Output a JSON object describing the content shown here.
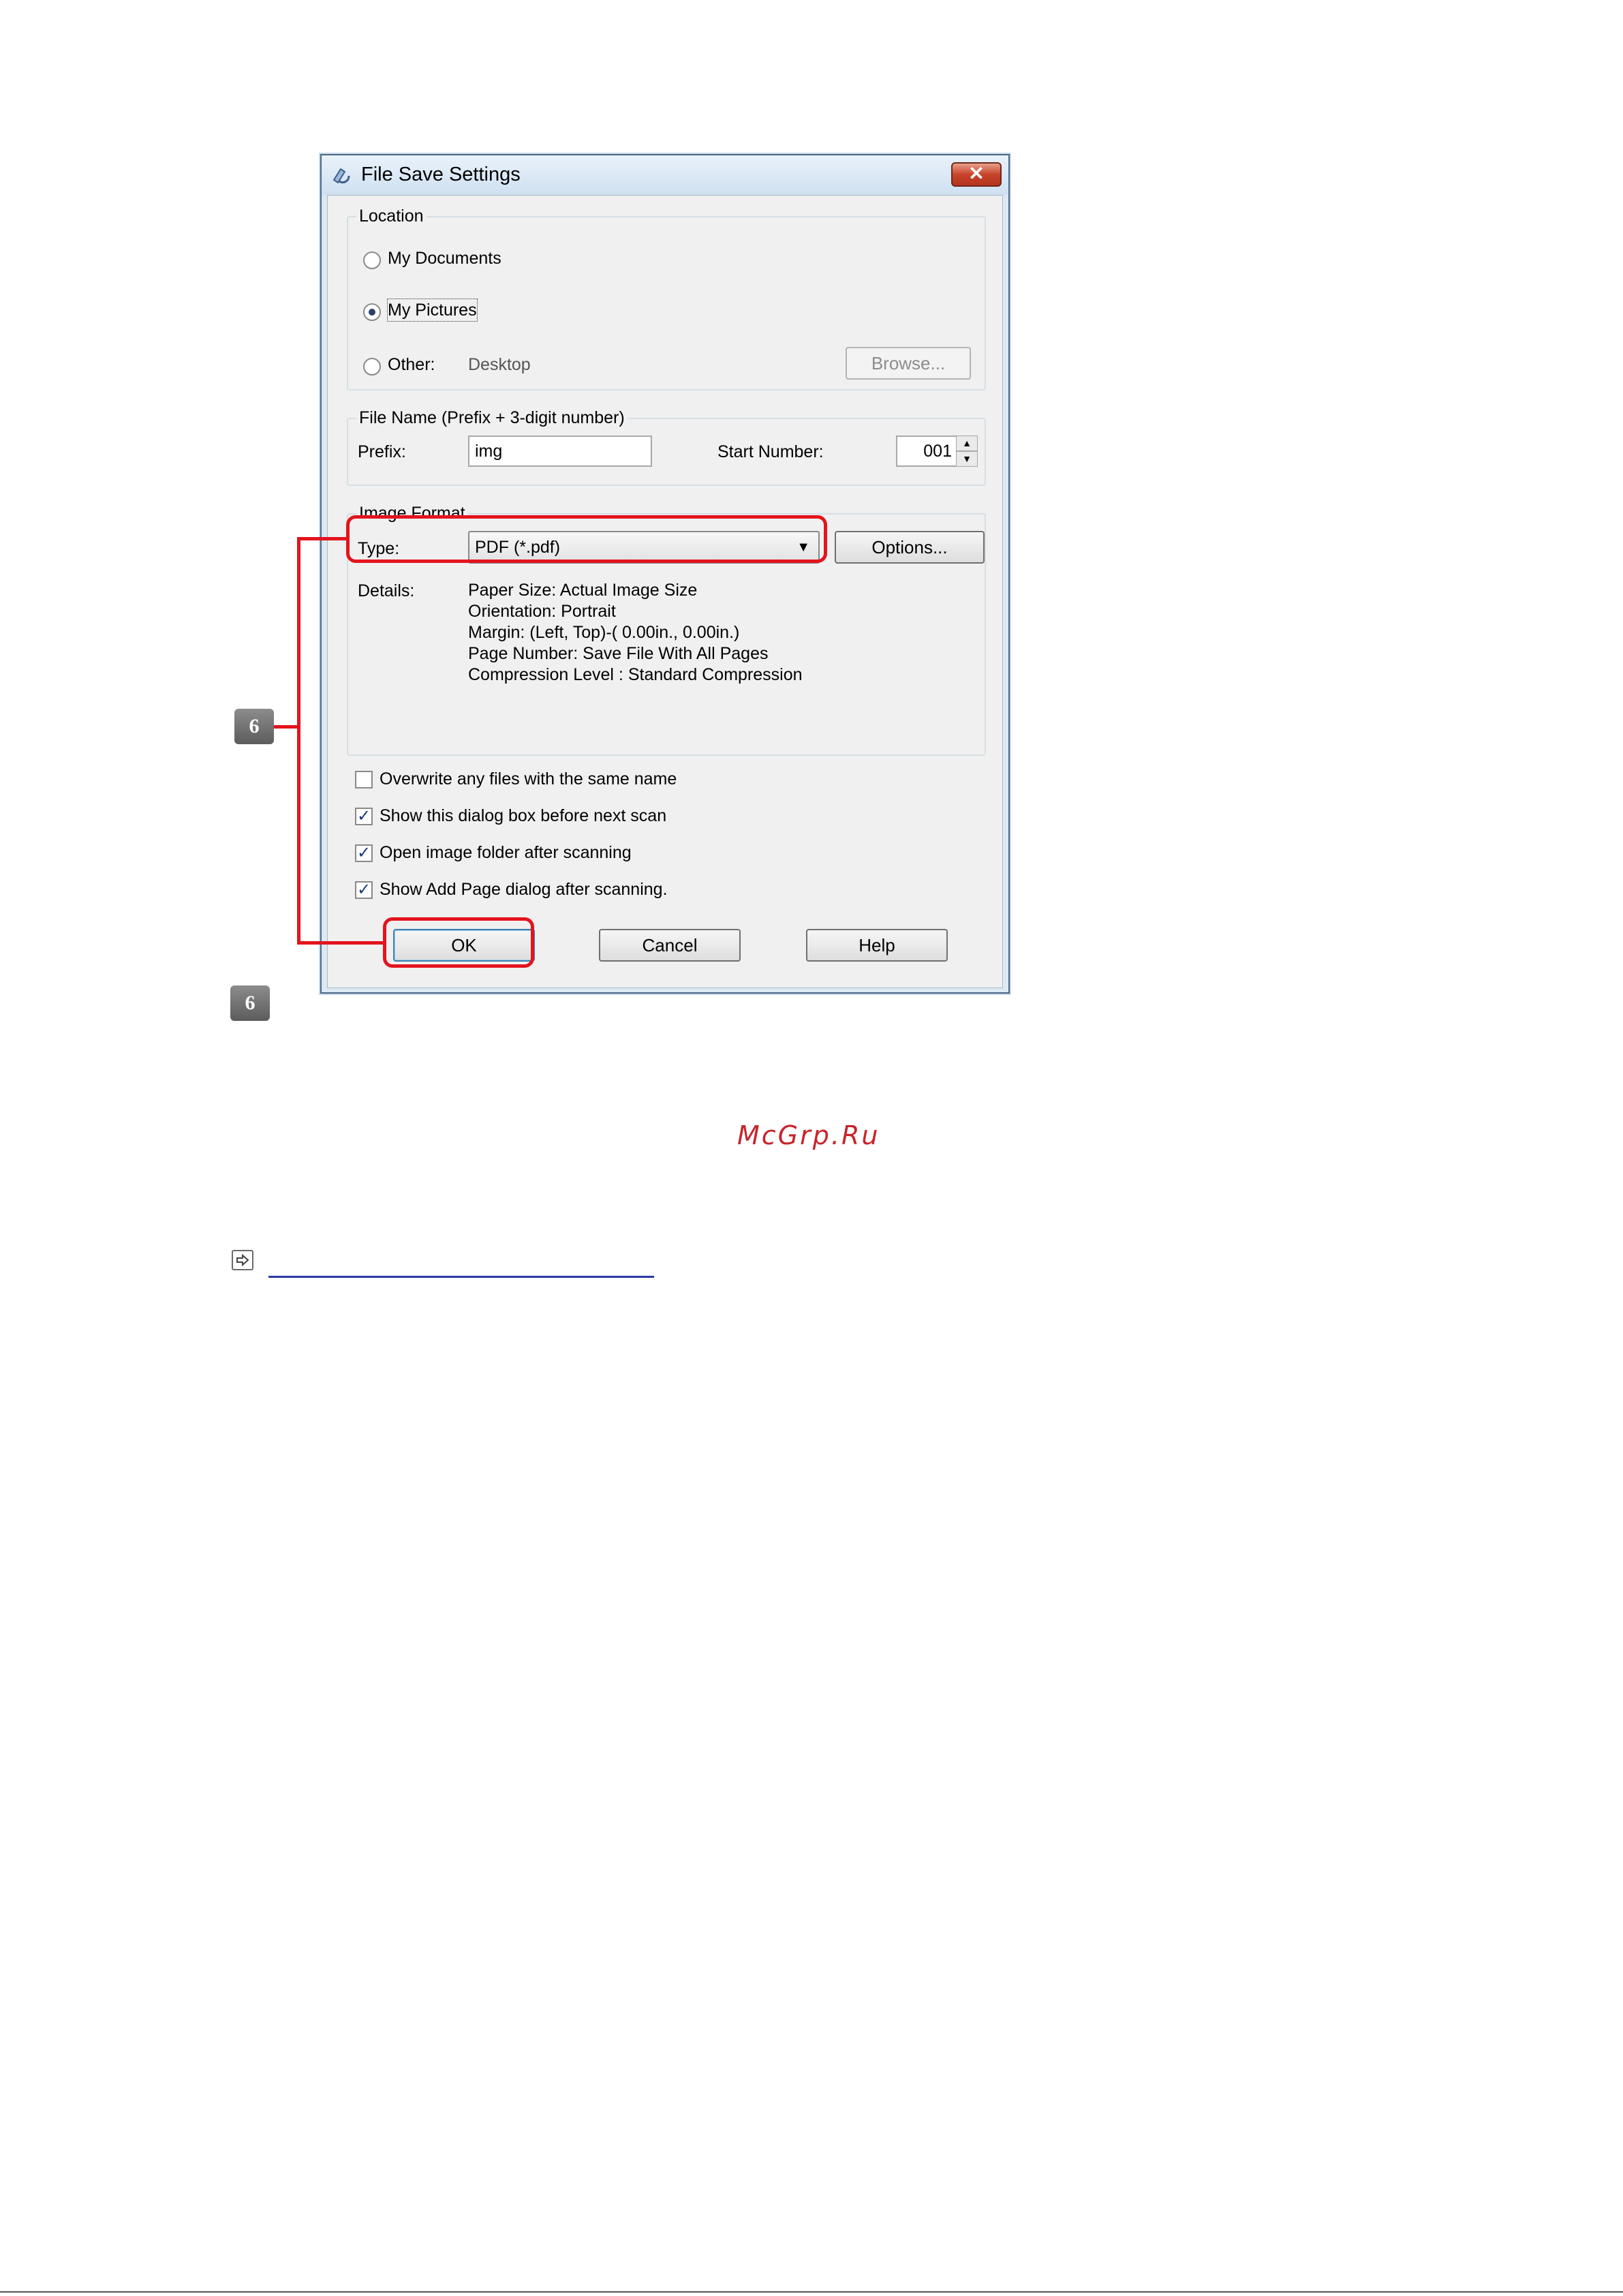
{
  "dialog": {
    "title": "File Save Settings",
    "close_label": "✕",
    "location": {
      "group_label": "Location",
      "option_documents": "My Documents",
      "option_pictures": "My Pictures",
      "option_other": "Other:",
      "other_path": "Desktop",
      "browse_label": "Browse...",
      "selected": "My Pictures"
    },
    "file_name": {
      "group_label": "File Name (Prefix + 3-digit number)",
      "prefix_label": "Prefix:",
      "prefix_value": "img",
      "start_number_label": "Start Number:",
      "start_number_value": "001"
    },
    "image_format": {
      "group_label": "Image Format",
      "type_label": "Type:",
      "type_value": "PDF (*.pdf)",
      "options_label": "Options...",
      "details_label": "Details:",
      "details": [
        "Paper Size: Actual Image Size",
        "Orientation: Portrait",
        "Margin: (Left, Top)-( 0.00in., 0.00in.)",
        "Page Number: Save File With All Pages",
        "Compression Level : Standard Compression"
      ]
    },
    "checkboxes": [
      {
        "label": "Overwrite any files with the same name",
        "checked": false
      },
      {
        "label": "Show this dialog box before next scan",
        "checked": true
      },
      {
        "label": "Open image folder after scanning",
        "checked": true
      },
      {
        "label": "Show Add Page dialog after scanning.",
        "checked": true
      }
    ],
    "buttons": {
      "ok": "OK",
      "cancel": "Cancel",
      "help": "Help"
    }
  },
  "annotations": {
    "step_number": "6",
    "highlight_color": "#e3141d"
  },
  "watermark": "McGrp.Ru",
  "icons": {
    "title": "scanner-app-icon",
    "link": "arrow-right-icon"
  }
}
